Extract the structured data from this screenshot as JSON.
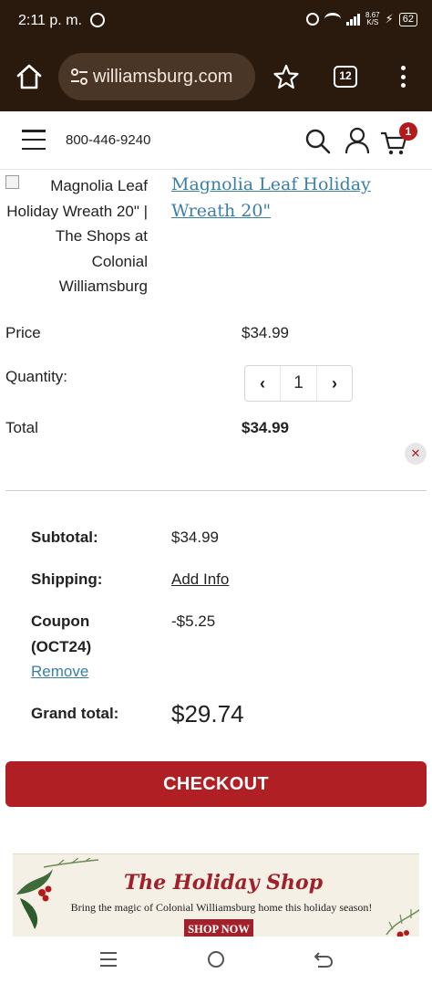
{
  "status_bar": {
    "time": "2:11 p. m.",
    "net_speed_value": "8.67",
    "net_speed_unit": "K/S",
    "battery": "62"
  },
  "browser": {
    "url": "williamsburg.com",
    "tab_count": "12"
  },
  "header": {
    "phone": "800-446-9240",
    "cart_count": "1"
  },
  "product": {
    "image_alt": "Magnolia Leaf Holiday Wreath 20\" | The Shops at Colonial Williamsburg",
    "name": "Magnolia Leaf Holiday Wreath 20\"",
    "price_label": "Price",
    "price": "$34.99",
    "quantity_label": "Quantity:",
    "quantity": "1",
    "total_label": "Total",
    "total": "$34.99",
    "remove_symbol": "✕"
  },
  "summary": {
    "subtotal_label": "Subtotal:",
    "subtotal": "$34.99",
    "shipping_label": "Shipping:",
    "shipping_action": "Add Info",
    "coupon_label_line1": "Coupon",
    "coupon_label_line2": "(OCT24)",
    "coupon_value": "-$5.25",
    "coupon_remove": "Remove",
    "grand_total_label": "Grand total:",
    "grand_total": "$29.74"
  },
  "checkout": {
    "label": "CHECKOUT"
  },
  "banner": {
    "title": "The Holiday Shop",
    "subtitle": "Bring the magic of Colonial Williamsburg home this holiday season!",
    "cta": "SHOP NOW"
  },
  "colors": {
    "brand_red": "#b01f24",
    "link_blue": "#3a7fa6",
    "browser_bg": "#2a1a0e"
  },
  "icons": [
    "whatsapp-icon",
    "alarm-icon",
    "wifi-icon",
    "signal-icon",
    "bolt-icon",
    "battery-icon",
    "home-icon",
    "site-settings-icon",
    "star-icon",
    "tabs-icon",
    "more-icon",
    "menu-icon",
    "search-icon",
    "account-icon",
    "cart-icon",
    "remove-icon",
    "recent-apps-icon",
    "nav-home-icon",
    "nav-back-icon"
  ]
}
